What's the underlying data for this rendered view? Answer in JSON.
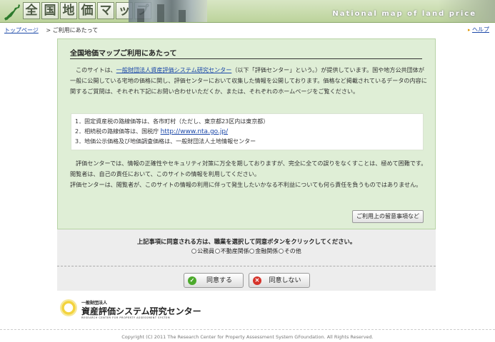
{
  "header": {
    "title_chars": [
      "全",
      "国",
      "地",
      "価",
      "マ",
      "ッ",
      "プ"
    ],
    "english_title": "National map of land price",
    "logo_icon": "japan-map-icon"
  },
  "breadcrumb": {
    "home": "トップページ",
    "separator": ">",
    "current": "ご利用にあたって"
  },
  "help": {
    "label": "ヘルプ"
  },
  "panel": {
    "title": "全国地価マップご利用にあたって",
    "intro_1": "このサイトは、",
    "intro_link": "一般財団法人資産評価システム研究センター",
    "intro_2": "（以下「評価センター」という。）が提供しています。国や地方公共団体が一般に公開している宅地の価格に関し、評価センターにおいて収集した情報を公開しております。価格など掲載されているデータの内容に関するご質問は、それぞれ下記にお問い合わせいただくか、または、それぞれのホームページをご覧ください。",
    "list": [
      {
        "text": "1．固定資産税の路線価等は、各市町村（ただし、東京都23区内は東京都）",
        "link": ""
      },
      {
        "text": "2．相続税の路線価等は、国税庁 ",
        "link": "http://www.nta.go.jp/"
      },
      {
        "text": "3．地価公示価格及び地価調査価格は、一般財団法人土地情報センター",
        "link": ""
      }
    ],
    "disclaimer_1": "評価センターでは、情報の正確性やセキュリティ対策に万全を期しておりますが、完全に全ての誤りをなくすことは、極めて困難です。閲覧者は、自己の責任において、このサイトの情報を利用してください。",
    "disclaimer_2": "評価センターは、閲覧者が、このサイトの情報の利用に伴って発生したいかなる不利益についても何ら責任を負うものではありません。",
    "notes_button": "ご利用上の留意事項など"
  },
  "agree": {
    "prompt": "上記事項に同意される方は、職業を選択して同意ボタンをクリックしてください。",
    "occupations": [
      "公務員",
      "不動産関係",
      "金融関係",
      "その他"
    ],
    "agree_button": "同意する",
    "disagree_button": "同意しない"
  },
  "org": {
    "prefix": "一般財団法人",
    "name": "資産評価システム研究センター",
    "english": "RESEARCH CENTER FOR PROPERTY ASSESSMENT SYSTEM"
  },
  "footer": {
    "copyright": "Copyright (C) 2011 The Research Center for Property Assessment System GFoundation. All Rights Reserved."
  }
}
